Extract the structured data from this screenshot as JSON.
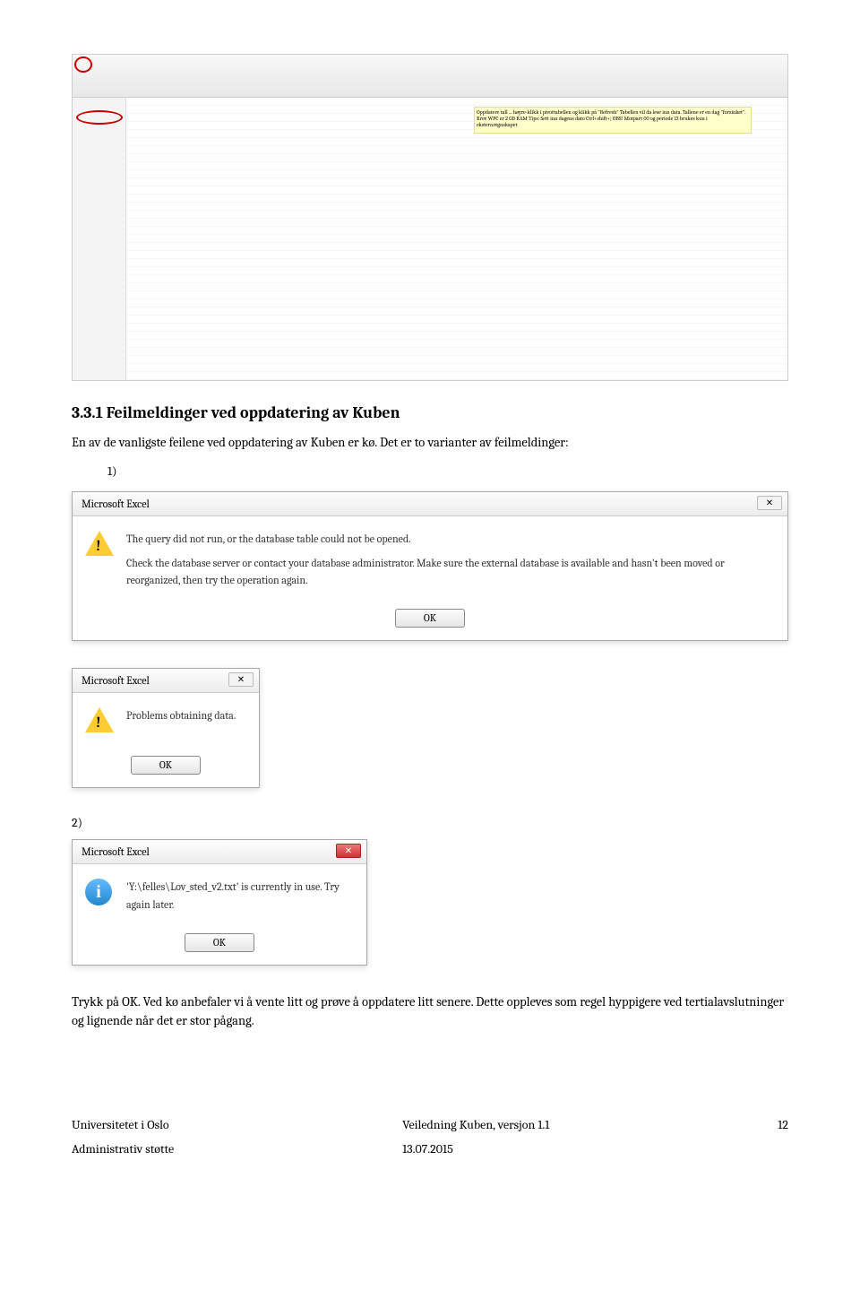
{
  "heading": "3.3.1 Feilmeldinger ved oppdatering av Kuben",
  "intro": "En av de vanligste feilene ved oppdatering av Kuben er kø. Det er to varianter av feilmeldinger:",
  "list1": "1)",
  "list2": "2)",
  "dialog1": {
    "title": "Microsoft Excel",
    "line1": "The query did not run, or the database table could not be opened.",
    "line2": "Check the database server or contact your database administrator. Make sure the external database is available and hasn't been moved or reorganized, then try the operation again.",
    "button": "OK",
    "close": "✕"
  },
  "dialog2": {
    "title": "Microsoft Excel",
    "text": "Problems obtaining data.",
    "button": "OK",
    "close": "✕"
  },
  "dialog3": {
    "title": "Microsoft Excel",
    "text": "'Y:\\felles\\Lov_sted_v2.txt' is currently in use. Try again later.",
    "button": "OK",
    "close": "✕"
  },
  "closing": "Trykk på OK. Ved kø anbefaler vi å vente litt og prøve å oppdatere litt senere. Dette oppleves som regel hyppigere ved tertialavslutninger og lignende når det er stor pågang.",
  "excel_note": "Oppdatere tall ... høyre-klikk i pivottabellen og klikk på \"Refresh\"  Tabellen vil da lese inn data. Tallene er en dag \"forsinket\". Krev WPC er 2 GB RAM  Tips: Sett inn dagens dato Ctrl+shift+;  OBS! Motpart 00 og periode 13 brukes kun i eksternregnskapet",
  "footer": {
    "left1": "Universitetet i Oslo",
    "left2": "Administrativ støtte",
    "mid1": "Veiledning Kuben, versjon 1.1",
    "mid2": "13.07.2015",
    "right": "12"
  }
}
